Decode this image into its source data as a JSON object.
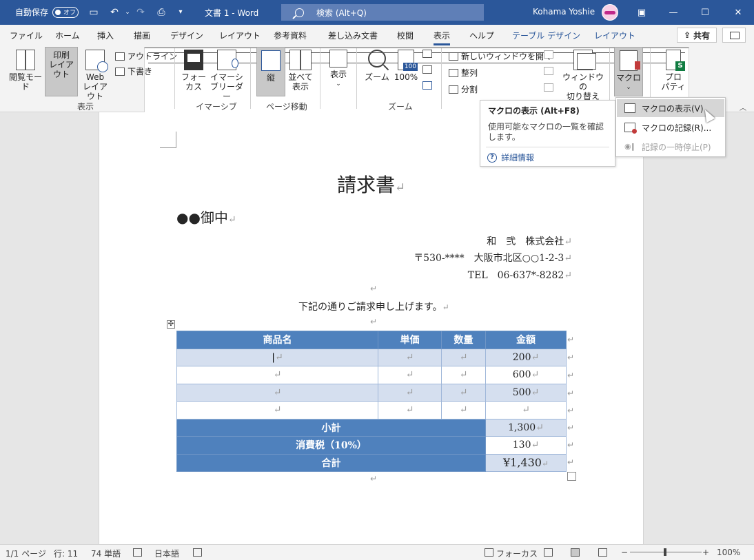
{
  "titlebar": {
    "autosave_label": "自動保存",
    "autosave_state": "オフ",
    "doc_title": "文書 1  -  Word",
    "search_placeholder": "検索 (Alt+Q)",
    "user_name": "Kohama Yoshie",
    "accent": "#2b579a"
  },
  "tabs": [
    "ファイル",
    "ホーム",
    "挿入",
    "描画",
    "デザイン",
    "レイアウト",
    "参考資料",
    "差し込み文書",
    "校閲",
    "表示",
    "ヘルプ",
    "テーブル デザイン",
    "レイアウト"
  ],
  "share_label": "共有",
  "ribbon": {
    "view": {
      "read_mode": "閲覧モード",
      "print_layout_1": "印刷",
      "print_layout_2": "レイアウト",
      "web_layout_1": "Web",
      "web_layout_2": "レイアウト",
      "outline": "アウトライン",
      "draft": "下書き",
      "group": "表示"
    },
    "immersive": {
      "focus_1": "フォー",
      "focus_2": "カス",
      "reader_1": "イマーシ",
      "reader_2": "ブリーダー",
      "group": "イマーシブ"
    },
    "page_move": {
      "vertical": "縦",
      "side_1": "並べて",
      "side_2": "表示",
      "group": "ページ移動"
    },
    "show": {
      "label": "表示"
    },
    "zoom": {
      "zoom": "ズーム",
      "hundred": "100%",
      "group": "ズーム"
    },
    "window": {
      "new_window": "新しいウィンドウを開く",
      "arrange": "整列",
      "split": "分割",
      "switch_1": "ウィンドウの",
      "switch_2": "切り替え"
    },
    "macro": {
      "label": "マクロ"
    },
    "properties": {
      "label_1": "プロ",
      "label_2": "パティ"
    }
  },
  "tooltip": {
    "title": "マクロの表示 (Alt+F8)",
    "body": "使用可能なマクロの一覧を確認します。",
    "link": "詳細情報"
  },
  "macro_menu": {
    "view": "マクロの表示(V)",
    "record": "マクロの記録(R)...",
    "pause": "記録の一時停止(P)"
  },
  "document": {
    "title": "請求書",
    "recipient": "●●御中",
    "company": "和　弐　株式会社",
    "address": "〒530-****　大阪市北区○○1-2-3",
    "tel": "TEL　06-637*-8282",
    "intro": "下記の通りご請求申し上げます。",
    "para_mark": "↵",
    "table": {
      "headers": [
        "商品名",
        "単価",
        "数量",
        "金額"
      ],
      "amounts": [
        "200",
        "600",
        "500",
        ""
      ],
      "subtotal_label": "小計",
      "subtotal": "1,300",
      "tax_label": "消費税（10%）",
      "tax": "130",
      "total_label": "合計",
      "total": "¥1,430"
    }
  },
  "statusbar": {
    "page": "1/1 ページ",
    "line": "行: 11",
    "words": "74 単語",
    "language": "日本語",
    "focus": "フォーカス",
    "zoom": "100%",
    "minus": "−",
    "plus": "+"
  }
}
